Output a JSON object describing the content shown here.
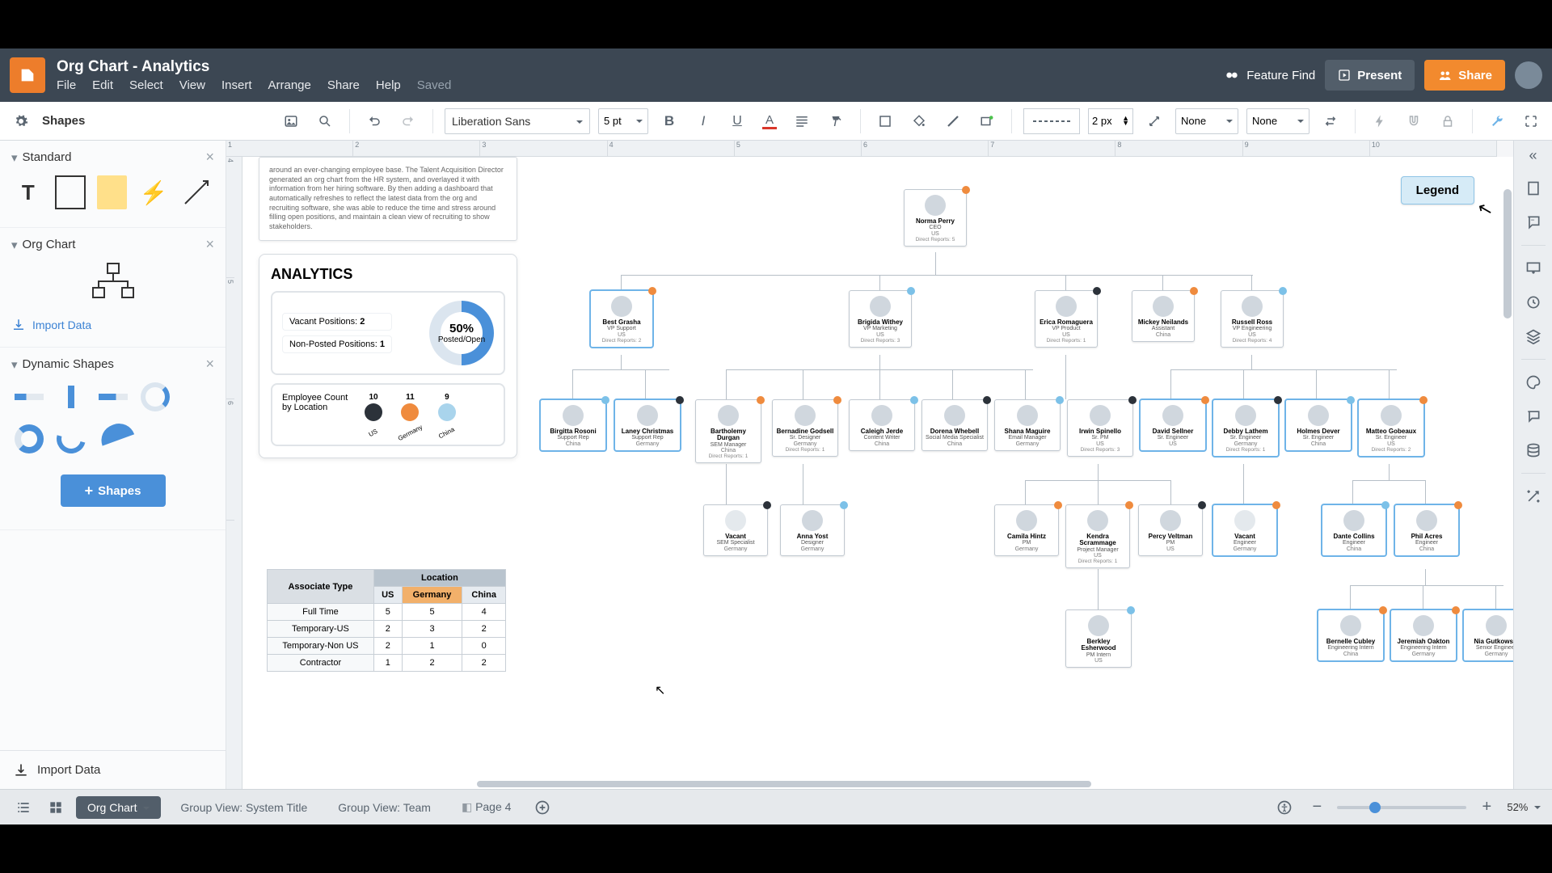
{
  "header": {
    "title": "Org Chart - Analytics",
    "menus": [
      "File",
      "Edit",
      "Select",
      "View",
      "Insert",
      "Arrange",
      "Share",
      "Help"
    ],
    "status": "Saved",
    "feature_find": "Feature Find",
    "present": "Present",
    "share": "Share"
  },
  "toolbar": {
    "shapes": "Shapes",
    "font": "Liberation Sans",
    "font_size": "5 pt",
    "line_width": "2 px",
    "line_start": "None",
    "line_end": "None"
  },
  "left": {
    "standard": "Standard",
    "orgchart": "Org Chart",
    "import": "Import Data",
    "dynamic": "Dynamic Shapes",
    "shapes_btn": "Shapes",
    "footer_import": "Import Data"
  },
  "canvas": {
    "note": "around an ever-changing employee base. The Talent Acquisition Director generated an org chart from the HR system, and overlayed it with information from her hiring software. By then adding a dashboard that automatically refreshes to reflect the latest data from the org and recruiting software, she was able to reduce the time and stress around filling open positions, and maintain a clean view of recruiting to show stakeholders.",
    "legend": "Legend",
    "analytics": {
      "title": "ANALYTICS",
      "vacant_label": "Vacant Positions:",
      "vacant_value": "2",
      "nonposted_label": "Non-Posted Positions:",
      "nonposted_value": "1",
      "donut_pct": "50%",
      "donut_caption": "Posted/Open",
      "emp_title": "Employee Count by Location",
      "emp_cols": [
        {
          "num": "10",
          "label": "US",
          "color": "#2c323a"
        },
        {
          "num": "11",
          "label": "Germany",
          "color": "#ef8b3e"
        },
        {
          "num": "9",
          "label": "China",
          "color": "#a9d4ec"
        }
      ]
    },
    "loc_table": {
      "corner": "Associate Type",
      "group": "Location",
      "cols": [
        "US",
        "Germany",
        "China"
      ],
      "rows": [
        {
          "label": "Full Time",
          "vals": [
            "5",
            "5",
            "4"
          ]
        },
        {
          "label": "Temporary-US",
          "vals": [
            "2",
            "3",
            "2"
          ]
        },
        {
          "label": "Temporary-Non US",
          "vals": [
            "2",
            "1",
            "0"
          ]
        },
        {
          "label": "Contractor",
          "vals": [
            "1",
            "2",
            "2"
          ]
        }
      ]
    }
  },
  "org": {
    "ceo": {
      "name": "Norma Perry",
      "role": "CEO",
      "loc": "US",
      "reports": "Direct Reports: 5",
      "dot": "sd-o"
    },
    "row2": [
      {
        "name": "Best Grasha",
        "role": "VP Support",
        "loc": "US",
        "reports": "Direct Reports: 2",
        "dot": "sd-o",
        "sel": true
      },
      {
        "name": "Brigida Withey",
        "role": "VP Marketing",
        "loc": "US",
        "reports": "Direct Reports: 3",
        "dot": "sd-b"
      },
      {
        "name": "Erica Romaguera",
        "role": "VP Product",
        "loc": "US",
        "reports": "Direct Reports: 1",
        "dot": "sd-d"
      },
      {
        "name": "Mickey Neilands",
        "role": "Assistant",
        "loc": "China",
        "reports": "",
        "dot": "sd-o"
      },
      {
        "name": "Russell Ross",
        "role": "VP Engineering",
        "loc": "US",
        "reports": "Direct Reports: 4",
        "dot": "sd-b"
      }
    ],
    "row3": [
      {
        "name": "Birgitta Rosoni",
        "role": "Support Rep",
        "loc": "China",
        "dot": "sd-b",
        "sel": true
      },
      {
        "name": "Laney Christmas",
        "role": "Support Rep",
        "loc": "Germany",
        "dot": "sd-d",
        "sel": true
      },
      {
        "name": "Bartholemy Durgan",
        "role": "SEM Manager",
        "loc": "China",
        "reports": "Direct Reports: 1",
        "dot": "sd-o"
      },
      {
        "name": "Bernadine Godsell",
        "role": "Sr. Designer",
        "loc": "Germany",
        "reports": "Direct Reports: 1",
        "dot": "sd-o"
      },
      {
        "name": "Caleigh Jerde",
        "role": "Content Writer",
        "loc": "China",
        "dot": "sd-b"
      },
      {
        "name": "Dorena Whebell",
        "role": "Social Media Specialist",
        "loc": "China",
        "dot": "sd-d"
      },
      {
        "name": "Shana Maguire",
        "role": "Email Manager",
        "loc": "Germany",
        "dot": "sd-b"
      },
      {
        "name": "Irwin Spinello",
        "role": "Sr. PM",
        "loc": "US",
        "reports": "Direct Reports: 3",
        "dot": "sd-d"
      },
      {
        "name": "David Sellner",
        "role": "Sr. Engineer",
        "loc": "US",
        "dot": "sd-o",
        "sel": true
      },
      {
        "name": "Debby Lathem",
        "role": "Sr. Engineer",
        "loc": "Germany",
        "reports": "Direct Reports: 1",
        "dot": "sd-d",
        "sel": true
      },
      {
        "name": "Holmes Dever",
        "role": "Sr. Engineer",
        "loc": "China",
        "dot": "sd-b",
        "sel": true
      },
      {
        "name": "Matteo Gobeaux",
        "role": "Sr. Engineer",
        "loc": "US",
        "reports": "Direct Reports: 2",
        "dot": "sd-o",
        "sel": true
      }
    ],
    "row4": [
      {
        "name": "Vacant",
        "role": "SEM Specialist",
        "loc": "Germany",
        "dot": "sd-d",
        "vac": true
      },
      {
        "name": "Anna Yost",
        "role": "Designer",
        "loc": "Germany",
        "dot": "sd-b"
      },
      {
        "name": "Camila Hintz",
        "role": "PM",
        "loc": "Germany",
        "dot": "sd-o"
      },
      {
        "name": "Kendra Scrammage",
        "role": "Project Manager",
        "loc": "US",
        "reports": "Direct Reports: 1",
        "dot": "sd-o"
      },
      {
        "name": "Percy Veltman",
        "role": "PM",
        "loc": "US",
        "dot": "sd-d"
      },
      {
        "name": "Vacant",
        "role": "Engineer",
        "loc": "Germany",
        "dot": "sd-o",
        "vac": true,
        "sel": true
      },
      {
        "name": "Dante Collins",
        "role": "Engineer",
        "loc": "China",
        "dot": "sd-b",
        "sel": true
      },
      {
        "name": "Phil Acres",
        "role": "Engineer",
        "loc": "China",
        "dot": "sd-o",
        "sel": true
      }
    ],
    "row5": [
      {
        "name": "Berkley Esherwood",
        "role": "PM Intern",
        "loc": "US",
        "dot": "sd-b"
      },
      {
        "name": "Bernelle Cubley",
        "role": "Engineering Intern",
        "loc": "China",
        "dot": "sd-o",
        "sel": true
      },
      {
        "name": "Jeremiah Oakton",
        "role": "Engineering Intern",
        "loc": "Germany",
        "dot": "sd-o",
        "sel": true
      },
      {
        "name": "Nia Gutkowski",
        "role": "Senior Engineer",
        "loc": "Germany",
        "dot": "sd-d",
        "sel": true
      }
    ]
  },
  "bottombar": {
    "tabs": [
      "Org Chart",
      "Group View: System Title",
      "Group View: Team",
      "Page 4"
    ],
    "zoom": "52%"
  },
  "chart_data": [
    {
      "type": "pie",
      "title": "Posted/Open",
      "categories": [
        "Posted",
        "Open"
      ],
      "values": [
        50,
        50
      ],
      "annotations": [
        "50%"
      ]
    },
    {
      "type": "bar",
      "title": "Employee Count by Location",
      "categories": [
        "US",
        "Germany",
        "China"
      ],
      "values": [
        10,
        11,
        9
      ],
      "ylim": [
        0,
        12
      ]
    },
    {
      "type": "table",
      "title": "Associate Type by Location",
      "columns": [
        "Associate Type",
        "US",
        "Germany",
        "China"
      ],
      "rows": [
        [
          "Full Time",
          5,
          5,
          4
        ],
        [
          "Temporary-US",
          2,
          3,
          2
        ],
        [
          "Temporary-Non US",
          2,
          1,
          0
        ],
        [
          "Contractor",
          1,
          2,
          2
        ]
      ]
    }
  ]
}
